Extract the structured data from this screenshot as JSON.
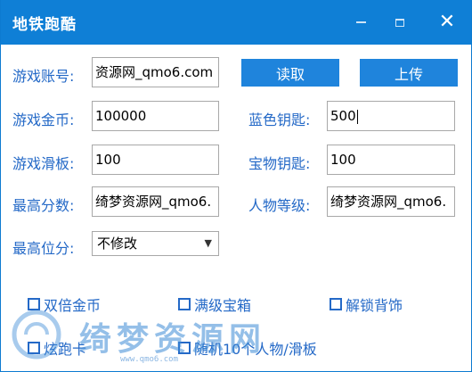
{
  "window": {
    "title": "地铁跑酷",
    "min_icon": "minimize-icon",
    "max_icon": "maximize-icon",
    "close_icon": "close-icon",
    "close_glyph": "✕",
    "accent": "#0f7fd6",
    "label_color": "#2469c7"
  },
  "fields": {
    "account_label": "游戏账号:",
    "account_value": "资源网_qmo6.com",
    "coins_label": "游戏金币:",
    "coins_value": "100000",
    "board_label": "游戏滑板:",
    "board_value": "100",
    "highscore_label": "最高分数:",
    "highscore_value": "绮梦资源网_qmo6.",
    "blue_key_label": "蓝色钥匙:",
    "blue_key_value": "500",
    "treasure_key_label": "宝物钥匙:",
    "treasure_key_value": "100",
    "char_level_label": "人物等级:",
    "char_level_value": "绮梦资源网_qmo6.",
    "highrank_label": "最高位分:",
    "highrank_value": "不修改"
  },
  "buttons": {
    "read": "读取",
    "upload": "上传"
  },
  "checkboxes": [
    {
      "label": "双倍金币",
      "checked": false
    },
    {
      "label": "满级宝箱",
      "checked": false
    },
    {
      "label": "解锁背饰",
      "checked": false
    },
    {
      "label": "炫跑卡",
      "checked": false
    },
    {
      "label": "随机10个人物/滑板",
      "checked": false
    }
  ],
  "watermark": {
    "text": "绮梦资源网",
    "url": "www.qmo6.com"
  }
}
